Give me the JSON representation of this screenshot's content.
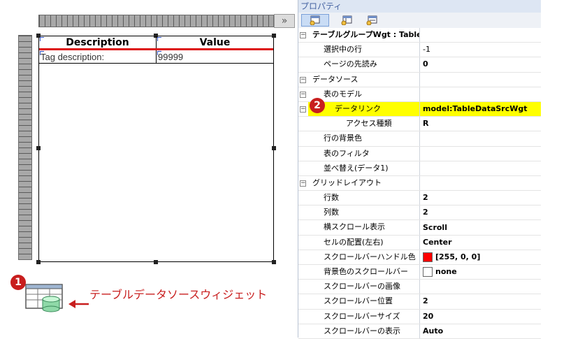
{
  "design": {
    "ruler_button": "»",
    "table": {
      "headers": [
        "Description",
        "Value"
      ],
      "row": [
        "Tag description:",
        "99999"
      ]
    },
    "badge_1": "1",
    "badge_2": "2",
    "widget_caption": "テーブルデータソースウィジェット"
  },
  "props": {
    "title": "プロパティ",
    "rows": [
      {
        "name": "テーブルグループWgt : TableWgt",
        "value": "",
        "toggle": "minus",
        "indent": 0,
        "bold_name": true
      },
      {
        "name": "選択中の行",
        "value": "-1",
        "indent": 1,
        "plain": true
      },
      {
        "name": "ページの先読み",
        "value": "0",
        "indent": 1
      },
      {
        "name": "データソース",
        "value": "",
        "toggle": "minus",
        "indent": 0
      },
      {
        "name": "表のモデル",
        "value": "",
        "toggle": "minus",
        "indent": 1
      },
      {
        "name": "データリンク",
        "value": "model:TableDataSrcWgt",
        "toggle": "minus",
        "indent": 2,
        "selected": true
      },
      {
        "name": "アクセス種類",
        "value": "R",
        "indent": 3
      },
      {
        "name": "行の背景色",
        "value": "",
        "indent": 1
      },
      {
        "name": "表のフィルタ",
        "value": "",
        "indent": 1
      },
      {
        "name": "並べ替え(データ1)",
        "value": "",
        "indent": 1
      },
      {
        "name": "グリッドレイアウト",
        "value": "",
        "toggle": "minus",
        "indent": 0
      },
      {
        "name": "行数",
        "value": "2",
        "indent": 1
      },
      {
        "name": "列数",
        "value": "2",
        "indent": 1
      },
      {
        "name": "横スクロール表示",
        "value": "Scroll",
        "indent": 1
      },
      {
        "name": "セルの配置(左右)",
        "value": "Center",
        "indent": 1
      },
      {
        "name": "スクロールバーハンドル色",
        "value": "[255, 0, 0]",
        "swatch": "#ff0000",
        "indent": 1
      },
      {
        "name": "背景色のスクロールバー",
        "value": "none",
        "swatch": "#ffffff",
        "indent": 1
      },
      {
        "name": "スクロールバーの画像",
        "value": "",
        "indent": 1
      },
      {
        "name": "スクロールバー位置",
        "value": "2",
        "indent": 1
      },
      {
        "name": "スクロールバーサイズ",
        "value": "20",
        "indent": 1
      },
      {
        "name": "スクロールバーの表示",
        "value": "Auto",
        "indent": 1
      }
    ]
  },
  "colors": {
    "accent_red": "#c81e1e",
    "selection": "#ffff00"
  }
}
